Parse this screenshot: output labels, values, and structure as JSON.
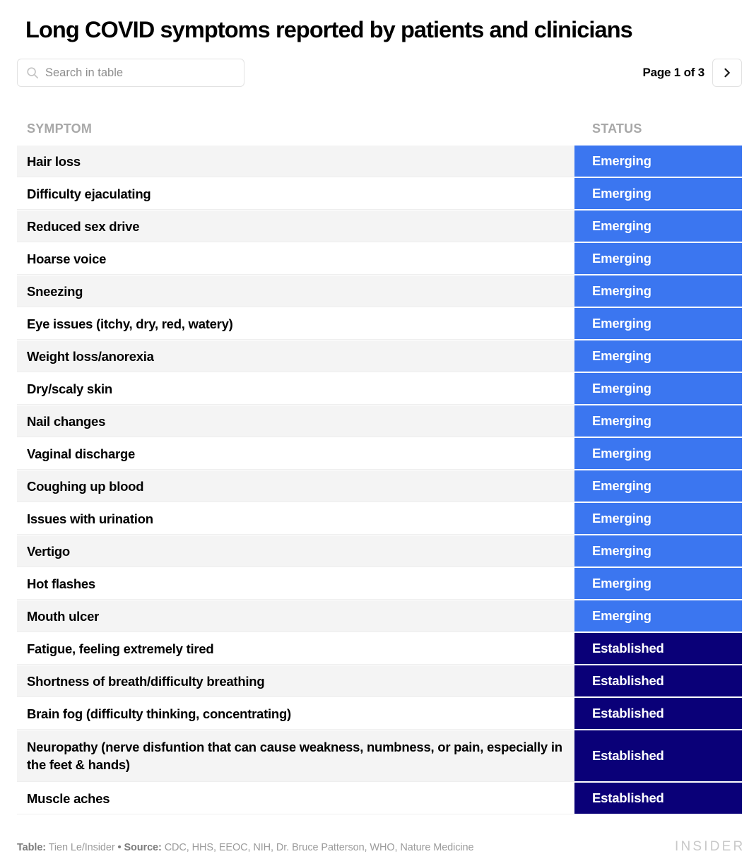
{
  "header": {
    "title": "Long COVID symptoms reported by patients and clinicians"
  },
  "search": {
    "placeholder": "Search in table",
    "value": "",
    "icon": "search-icon"
  },
  "pagination": {
    "label": "Page 1 of 3",
    "current_page": 1,
    "total_pages": 3,
    "next_icon": "chevron-right-icon"
  },
  "table": {
    "columns": [
      "SYMPTOM",
      "STATUS"
    ],
    "colors": {
      "emerging": "#3b76f0",
      "established": "#0a0078",
      "row_alt": "#f4f4f4",
      "row_base": "#ffffff",
      "header_text": "#a8a8a8"
    },
    "rows": [
      {
        "symptom": "Hair loss",
        "status": "Emerging"
      },
      {
        "symptom": "Difficulty ejaculating",
        "status": "Emerging"
      },
      {
        "symptom": "Reduced sex drive",
        "status": "Emerging"
      },
      {
        "symptom": "Hoarse voice",
        "status": "Emerging"
      },
      {
        "symptom": "Sneezing",
        "status": "Emerging"
      },
      {
        "symptom": "Eye issues (itchy, dry, red, watery)",
        "status": "Emerging"
      },
      {
        "symptom": "Weight loss/anorexia",
        "status": "Emerging"
      },
      {
        "symptom": "Dry/scaly skin",
        "status": "Emerging"
      },
      {
        "symptom": "Nail changes",
        "status": "Emerging"
      },
      {
        "symptom": "Vaginal discharge",
        "status": "Emerging"
      },
      {
        "symptom": "Coughing up blood",
        "status": "Emerging"
      },
      {
        "symptom": "Issues with urination",
        "status": "Emerging"
      },
      {
        "symptom": "Vertigo",
        "status": "Emerging"
      },
      {
        "symptom": "Hot flashes",
        "status": "Emerging"
      },
      {
        "symptom": "Mouth ulcer",
        "status": "Emerging"
      },
      {
        "symptom": "Fatigue, feeling extremely tired",
        "status": "Established"
      },
      {
        "symptom": "Shortness of breath/difficulty breathing",
        "status": "Established"
      },
      {
        "symptom": "Brain fog (difficulty thinking, concentrating)",
        "status": "Established"
      },
      {
        "symptom": "Neuropathy (nerve disfuntion that can cause weakness, numbness, or pain, especially in the feet & hands)",
        "status": "Established"
      },
      {
        "symptom": "Muscle aches",
        "status": "Established"
      }
    ]
  },
  "footer": {
    "table_label": "Table:",
    "table_credit": "Tien Le/Insider",
    "separator": "•",
    "source_label": "Source:",
    "source_credit": "CDC, HHS, EEOC, NIH, Dr. Bruce Patterson, WHO, Nature Medicine",
    "brand": "INSIDER"
  }
}
